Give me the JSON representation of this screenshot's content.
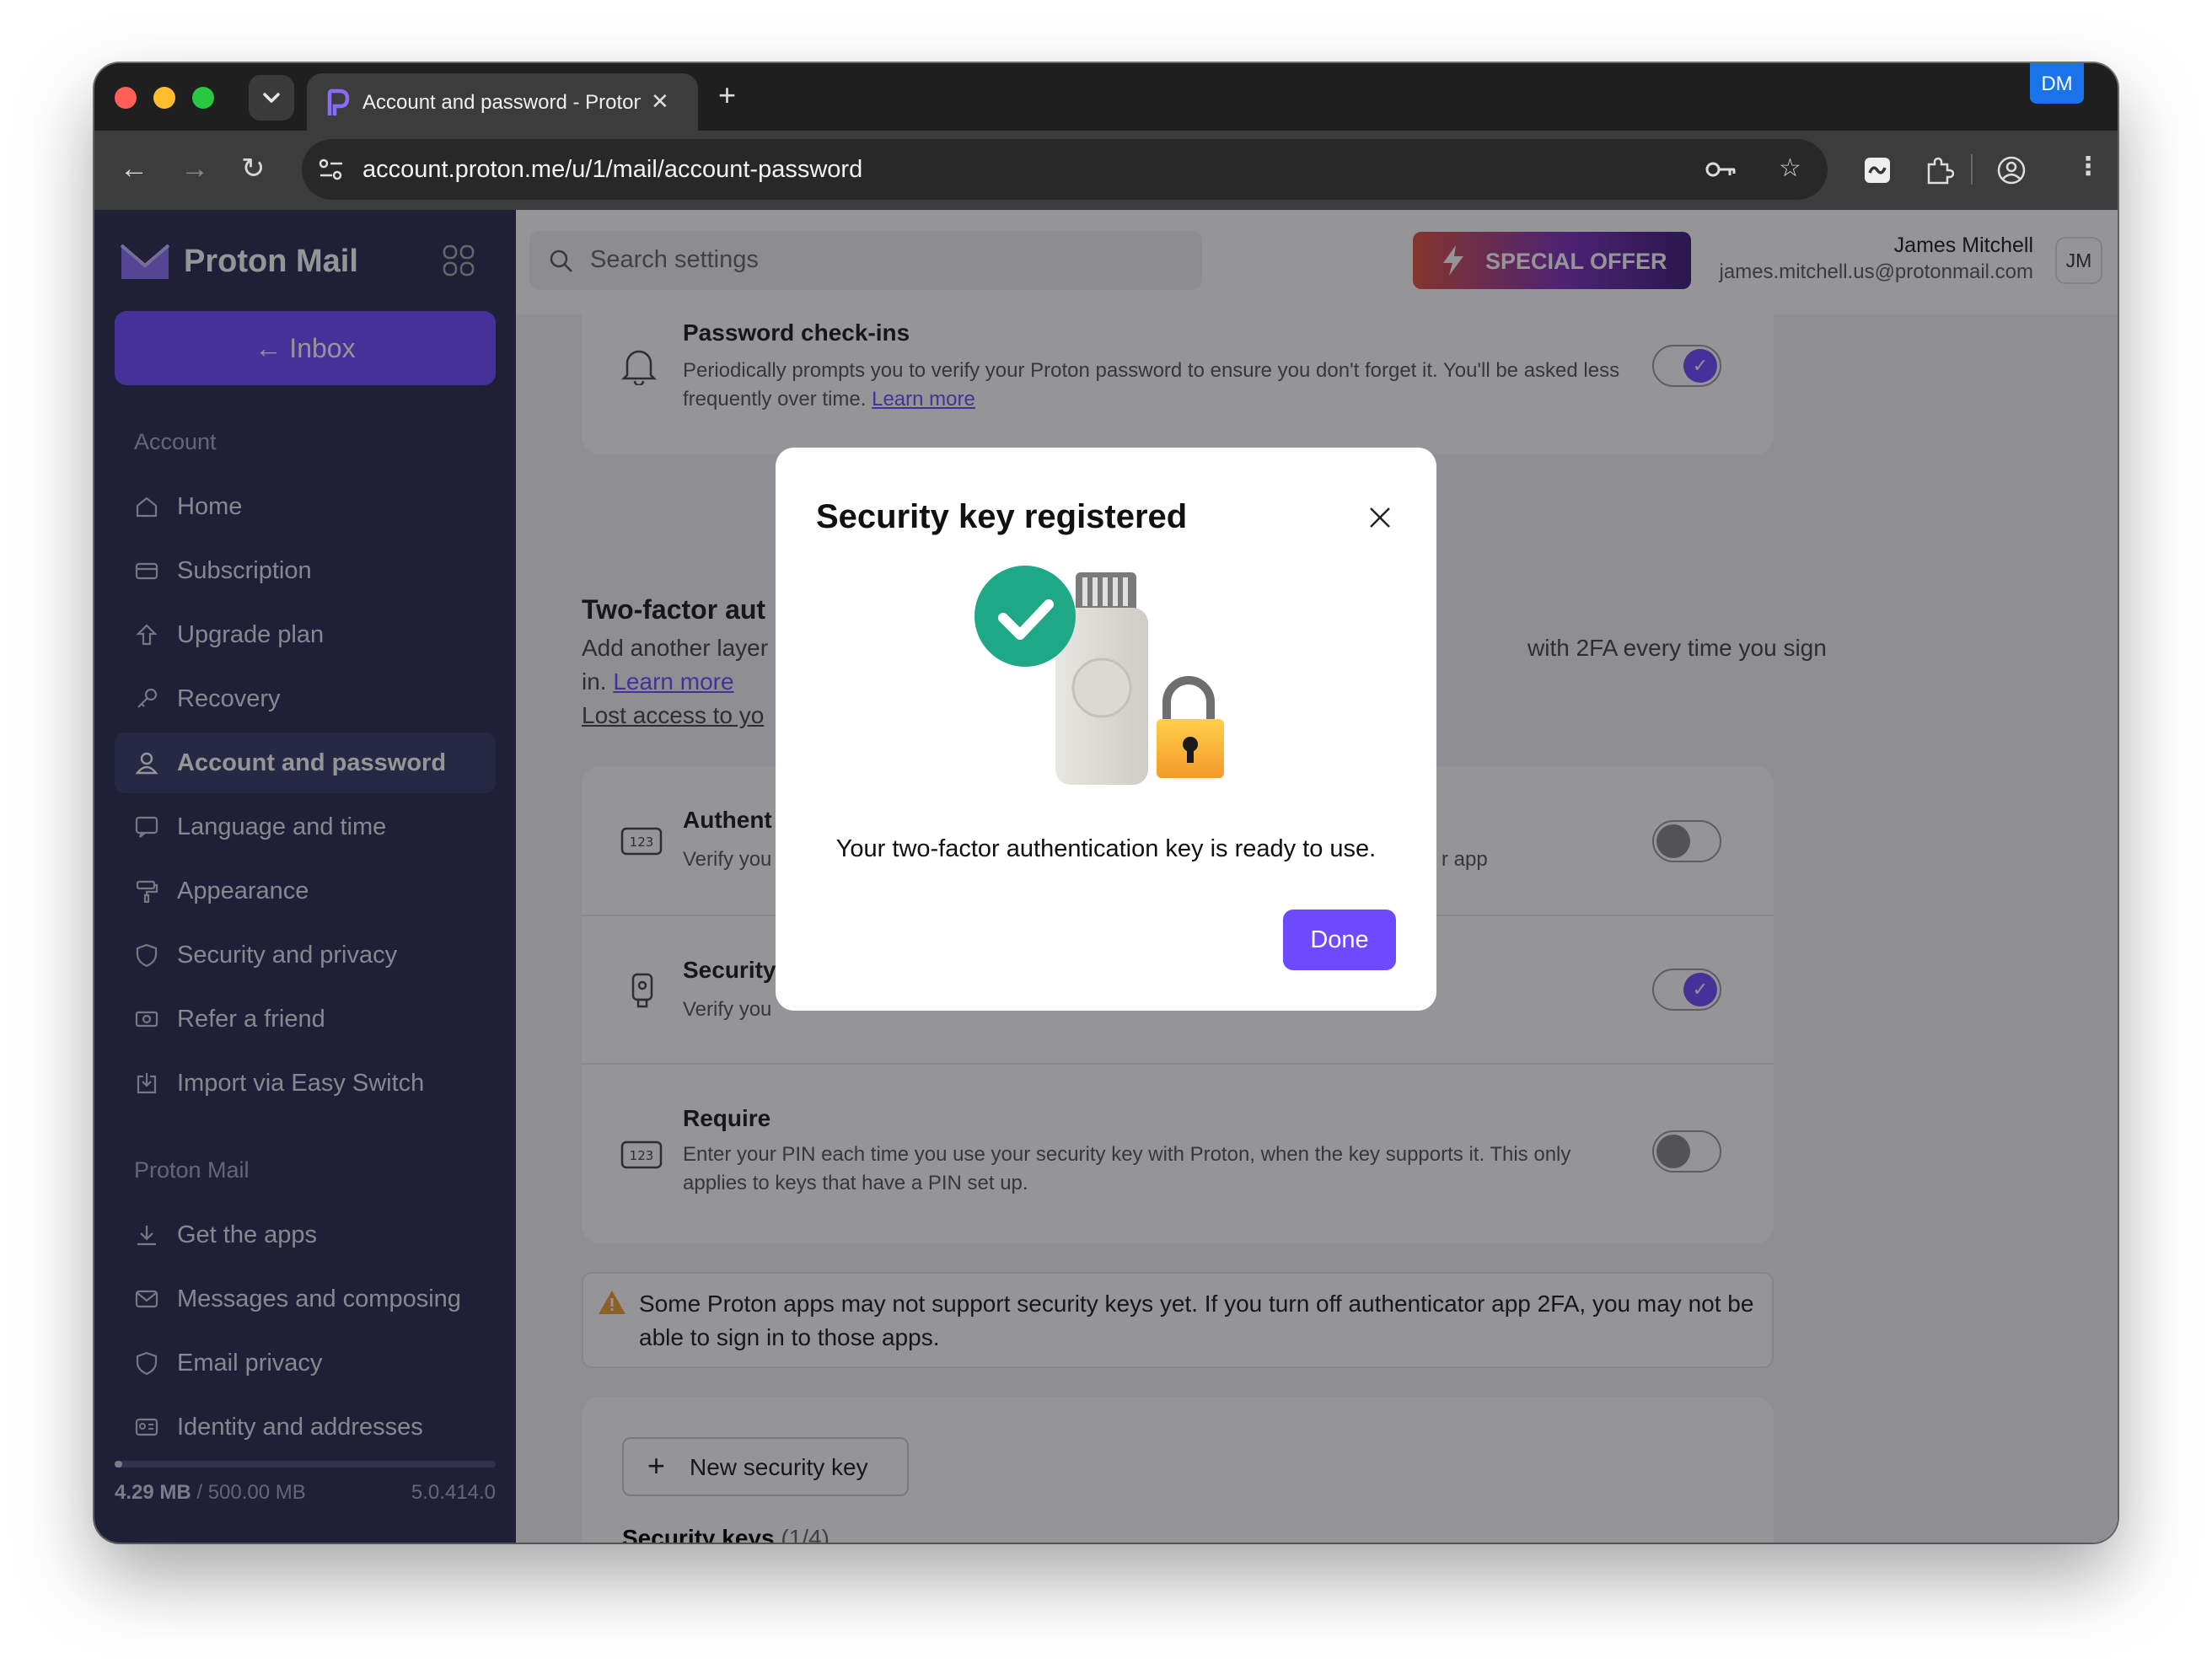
{
  "browser": {
    "tab_title": "Account and password - Proton",
    "url": "account.proton.me/u/1/mail/account-password",
    "profile_badge": "DM",
    "new_tab": "+"
  },
  "sidebar": {
    "logo": "Proton Mail",
    "inbox_button": "Inbox",
    "account_section": "Account",
    "account_items": [
      {
        "label": "Home",
        "icon": "home-icon"
      },
      {
        "label": "Subscription",
        "icon": "credit-card-icon"
      },
      {
        "label": "Upgrade plan",
        "icon": "upgrade-arrow-icon"
      },
      {
        "label": "Recovery",
        "icon": "key-icon"
      },
      {
        "label": "Account and password",
        "icon": "user-icon"
      },
      {
        "label": "Language and time",
        "icon": "language-icon"
      },
      {
        "label": "Appearance",
        "icon": "paint-roller-icon"
      },
      {
        "label": "Security and privacy",
        "icon": "shield-icon"
      },
      {
        "label": "Refer a friend",
        "icon": "money-icon"
      },
      {
        "label": "Import via Easy Switch",
        "icon": "import-icon"
      }
    ],
    "mail_section": "Proton Mail",
    "mail_items": [
      {
        "label": "Get the apps",
        "icon": "download-icon"
      },
      {
        "label": "Messages and composing",
        "icon": "envelope-icon"
      },
      {
        "label": "Email privacy",
        "icon": "shield-icon"
      },
      {
        "label": "Identity and addresses",
        "icon": "id-card-icon"
      }
    ],
    "storage_used": "4.29 MB",
    "storage_total": "/ 500.00 MB",
    "storage_fraction": 0.0086,
    "version": "5.0.414.0"
  },
  "topbar": {
    "search_placeholder": "Search settings",
    "offer": "SPECIAL OFFER",
    "user_name": "James Mitchell",
    "user_email": "james.mitchell.us@protonmail.com",
    "avatar": "JM"
  },
  "content": {
    "checkins_title": "Password check-ins",
    "checkins_desc": "Periodically prompts you to verify your Proton password to ensure you don't forget it. You'll be asked less frequently over time.",
    "learn_more": "Learn more",
    "twofa_title": "Two-factor aut",
    "twofa_desc_left": "Add another layer",
    "twofa_desc_in": "in.",
    "twofa_desc_right": "with 2FA every time you sign",
    "lost_access": "Lost access to yo",
    "auth_title": "Authent",
    "auth_desc": "Verify you",
    "auth_desc_right": "r app",
    "security_title": "Security",
    "security_desc": "Verify you",
    "require_title": "Require",
    "require_desc_1": "Enter your PIN each time you use your security key with Proton, when the key supports it. This only",
    "require_desc_2": "applies to keys that have a PIN set up.",
    "notice": "Some Proton apps may not support security keys yet. If you turn off authenticator app 2FA, you may not be able to sign in to those apps.",
    "new_key_button": "New security key",
    "keys_heading": "Security keys",
    "keys_count": "(1/4)"
  },
  "modal": {
    "title": "Security key registered",
    "message": "Your two-factor authentication key is ready to use.",
    "done": "Done"
  },
  "colors": {
    "brand": "#6d4aff",
    "sidebar": "#292a52",
    "success": "#1ea885",
    "warning": "#f0a030"
  }
}
